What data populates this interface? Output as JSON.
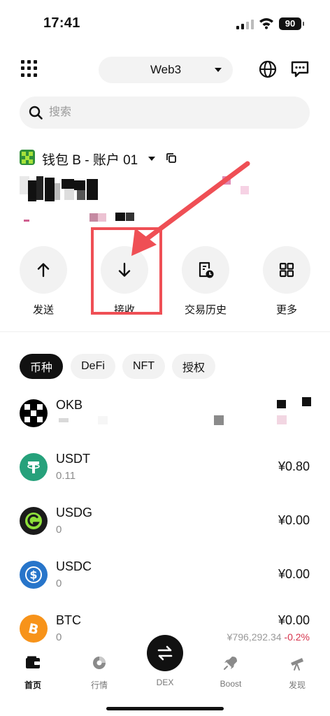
{
  "status_bar": {
    "time": "17:41",
    "battery": "90"
  },
  "header": {
    "network": "Web3"
  },
  "search": {
    "placeholder": "搜索"
  },
  "wallet": {
    "name": "钱包 B - 账户 01"
  },
  "actions": [
    {
      "label": "发送",
      "icon": "arrow-up-icon"
    },
    {
      "label": "接收",
      "icon": "arrow-down-icon"
    },
    {
      "label": "交易历史",
      "icon": "history-icon"
    },
    {
      "label": "更多",
      "icon": "grid-icon"
    }
  ],
  "tabs": [
    "币种",
    "DeFi",
    "NFT",
    "授权"
  ],
  "active_tab": "币种",
  "tokens": [
    {
      "symbol": "OKB",
      "amount": "",
      "value": "",
      "price": "",
      "change": ""
    },
    {
      "symbol": "USDT",
      "amount": "0.11",
      "value": "¥0.80",
      "price": "",
      "change": ""
    },
    {
      "symbol": "USDG",
      "amount": "0",
      "value": "¥0.00",
      "price": "",
      "change": ""
    },
    {
      "symbol": "USDC",
      "amount": "0",
      "value": "¥0.00",
      "price": "",
      "change": ""
    },
    {
      "symbol": "BTC",
      "amount": "0",
      "value": "¥0.00",
      "price": "¥796,292.34",
      "change": "-0.2%"
    }
  ],
  "bottom_nav": [
    {
      "label": "首页",
      "active": true
    },
    {
      "label": "行情",
      "active": false
    },
    {
      "label": "DEX",
      "active": false
    },
    {
      "label": "Boost",
      "active": false
    },
    {
      "label": "发现",
      "active": false
    }
  ],
  "colors": {
    "accent": "#111111",
    "highlight": "#ef4f55",
    "usdt": "#26a17b",
    "usdc": "#2775ca",
    "btc": "#f7931a",
    "negative": "#d6334c"
  }
}
